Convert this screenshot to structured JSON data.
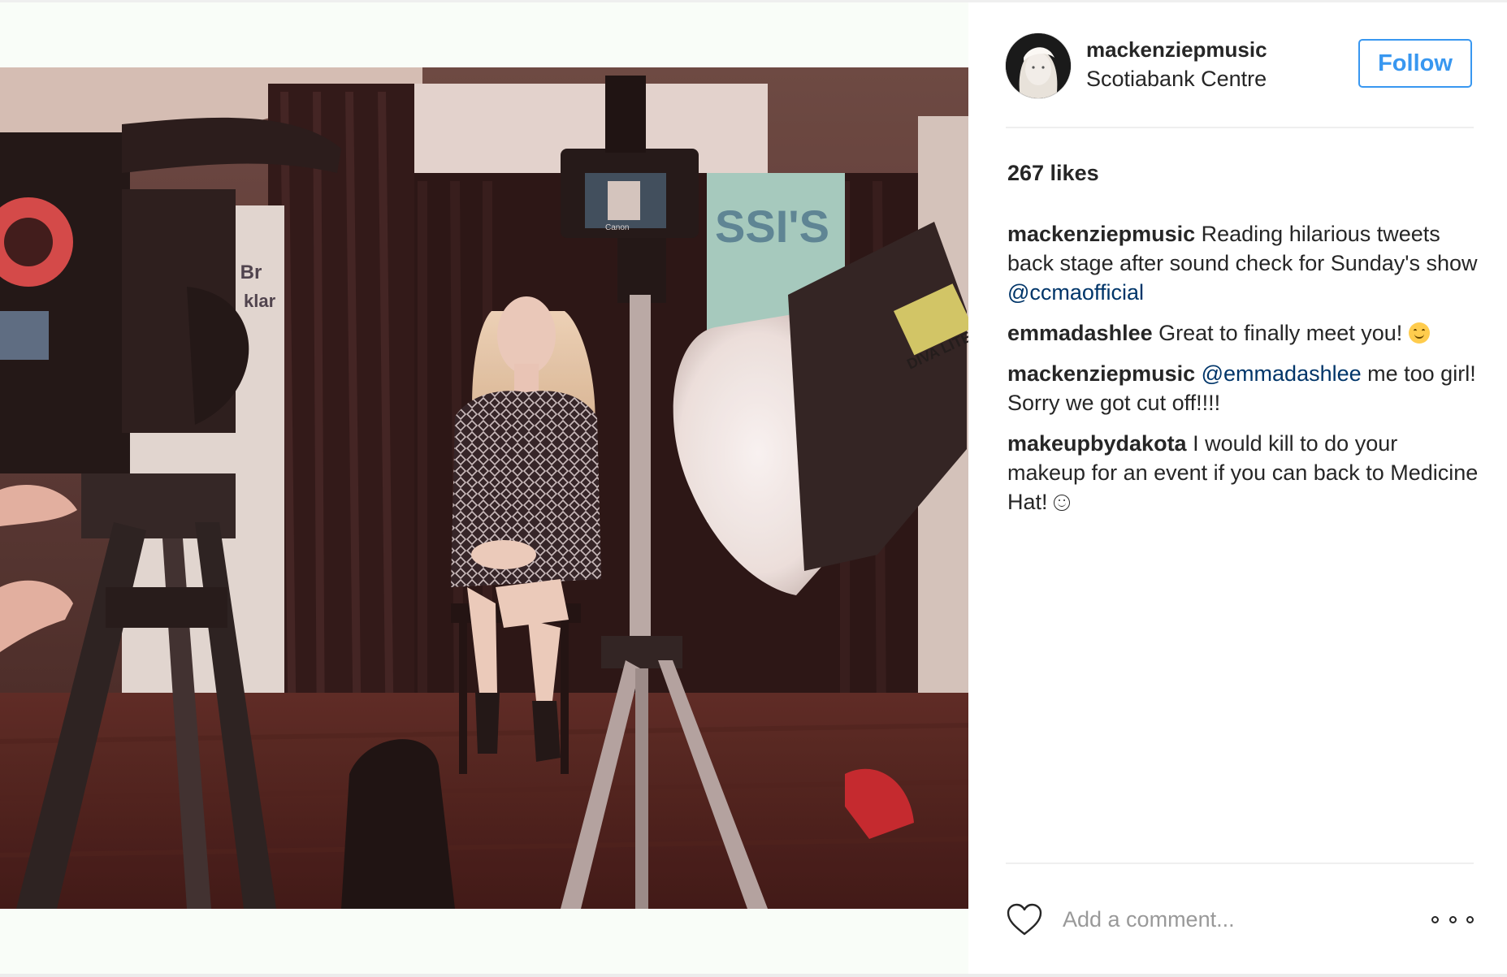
{
  "post": {
    "username": "mackenziepmusic",
    "location": "Scotiabank Centre",
    "follow_label": "Follow",
    "likes": "267 likes",
    "photo_alt": "photo",
    "photo_sign_text": "SSI'S",
    "photo_banner_text": "ur Br",
    "photo_banner_text2": "klar",
    "photo_light_text": "DIVA LITE",
    "photo_camera_text": "Canon"
  },
  "comments": [
    {
      "author": "mackenziepmusic",
      "text": "Reading hilarious tweets back stage after sound check for Sunday's show ",
      "mention": "@ccmaofficial",
      "text_after": "",
      "emoji": ""
    },
    {
      "author": "emmadashlee",
      "text": "Great to finally meet you! ",
      "mention": "",
      "text_after": "",
      "emoji": "smiling-face-emoji"
    },
    {
      "author": "mackenziepmusic",
      "text": "",
      "mention": "@emmadashlee",
      "text_after": " me too girl! Sorry we got cut off!!!!",
      "emoji": ""
    },
    {
      "author": "makeupbydakota",
      "text": "I would kill to do your makeup for an event if you can back to Medicine Hat! ",
      "mention": "",
      "text_after": "",
      "emoji": "white-smiley"
    }
  ],
  "comment_box": {
    "placeholder": "Add a comment..."
  },
  "icons": {
    "like": "heart-outline-icon",
    "more": "more-options-icon"
  },
  "colors": {
    "accent": "#3897f0",
    "mention": "#003569",
    "text": "#262626",
    "placeholder": "#999999",
    "divider": "#efefef"
  }
}
